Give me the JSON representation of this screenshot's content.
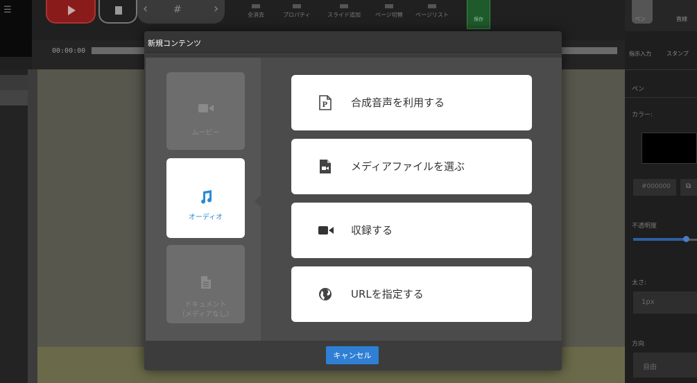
{
  "toolbar": {
    "timecode": "00:00:00",
    "tools": [
      "全消去",
      "プロパティ",
      "スライド追加",
      "ページ切替",
      "ページリスト"
    ],
    "save_label": "保存"
  },
  "right_panel": {
    "tabs": [
      "ペン",
      "直線"
    ],
    "sub_tools": [
      "指示入力",
      "スタンプ"
    ],
    "section_title": "ペン",
    "color_label": "カラー:",
    "color_value": "#000000",
    "opacity_label": "不透明度",
    "opacity_level": 0.8,
    "size_label": "太さ:",
    "size_value": "1px",
    "direction_label": "方向",
    "direction_value": "自由"
  },
  "modal": {
    "title": "新規コンテンツ",
    "categories": [
      {
        "label": "ムービー",
        "icon": "video-camera-icon",
        "active": false
      },
      {
        "label": "オーディオ",
        "icon": "music-note-icon",
        "active": true
      },
      {
        "label": "ドキュメント\n（メディアなし）",
        "icon": "document-icon",
        "active": false
      }
    ],
    "options": [
      {
        "label": "合成音声を利用する",
        "icon": "powerpoint-file-icon"
      },
      {
        "label": "メディアファイルを選ぶ",
        "icon": "media-file-icon"
      },
      {
        "label": "収録する",
        "icon": "video-camera-icon"
      },
      {
        "label": "URLを指定する",
        "icon": "globe-icon"
      }
    ],
    "cancel_label": "キャンセル"
  },
  "colors": {
    "accent": "#2a8ad4",
    "cancel_button": "#2f7fd4",
    "modal_bg": "#3c3c3c",
    "option_bg": "#ffffff"
  }
}
